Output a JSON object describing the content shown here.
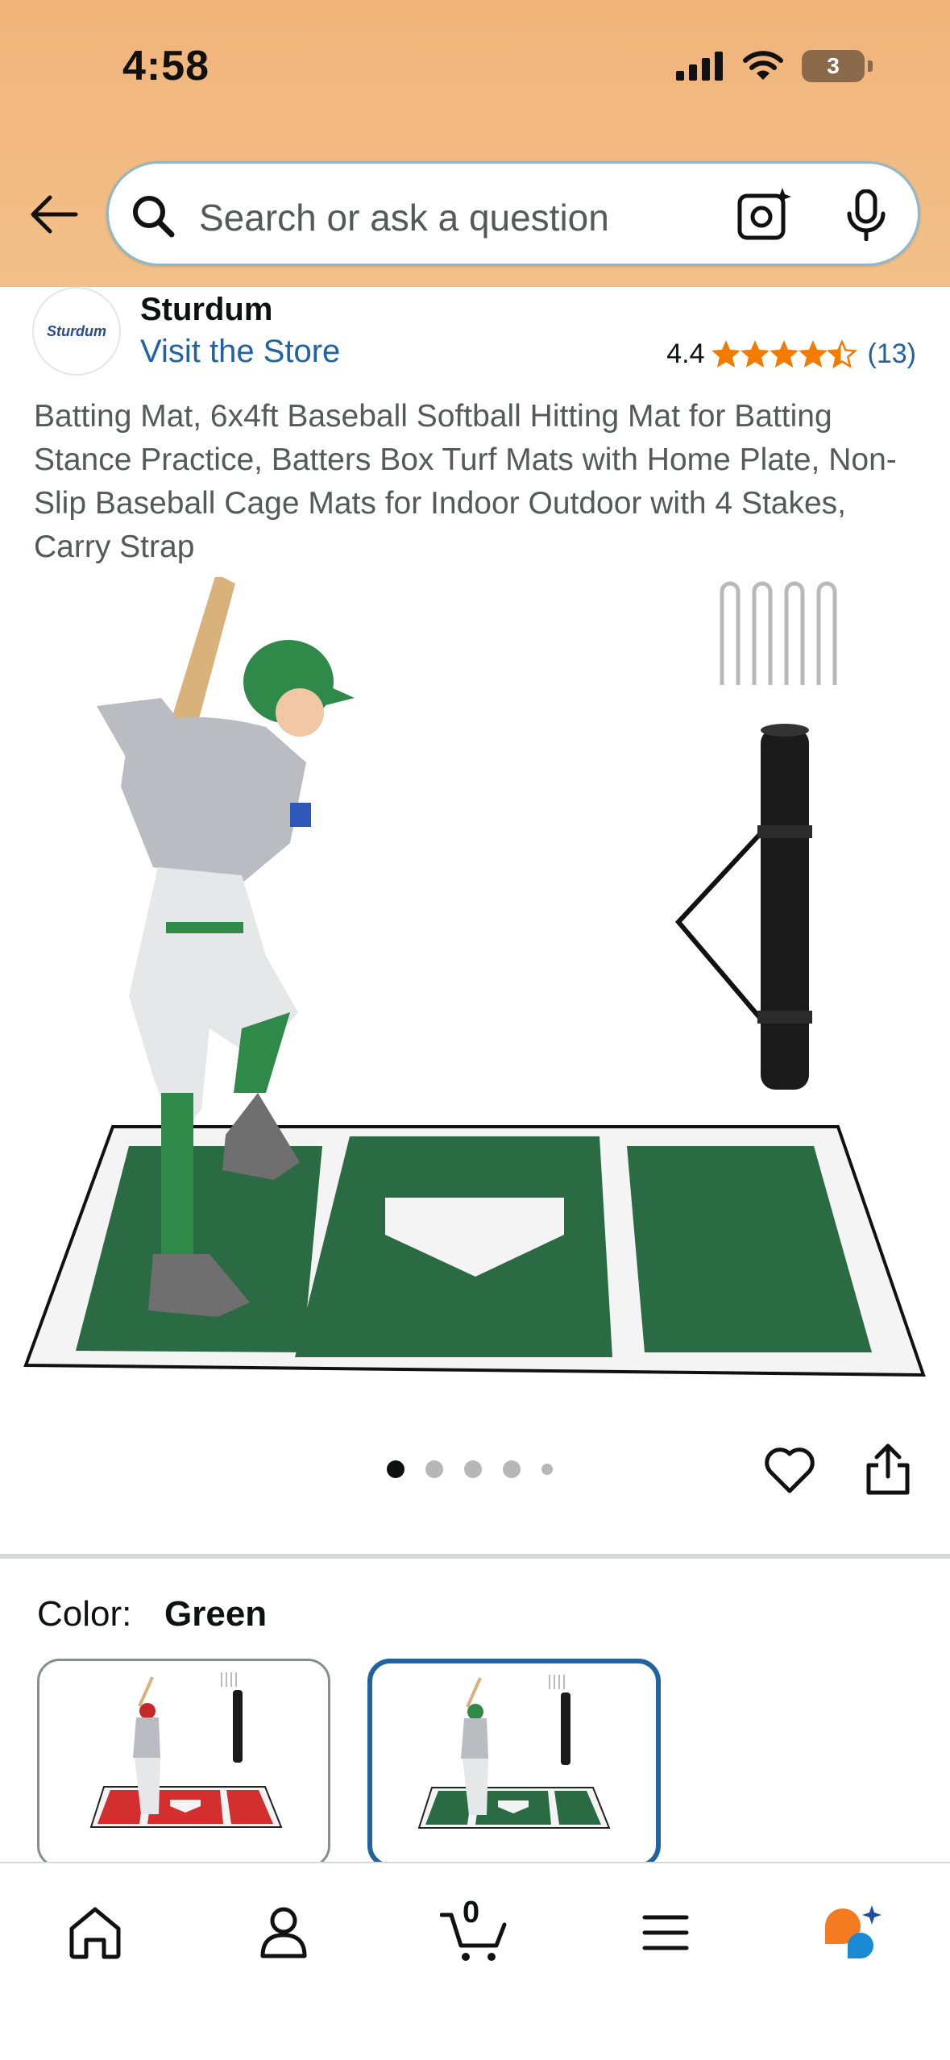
{
  "status_bar": {
    "time": "4:58",
    "battery": "3"
  },
  "search": {
    "placeholder": "Search or ask a question"
  },
  "brand": {
    "logo_text": "Sturdum",
    "name": "Sturdum",
    "visit_store": "Visit the Store"
  },
  "rating": {
    "value": "4.4",
    "stars": 4.4,
    "count": "(13)"
  },
  "product": {
    "title": "Batting Mat, 6x4ft Baseball Softball Hitting Mat for Batting Stance Practice, Batters Box Turf Mats with Home Plate, Non-Slip Baseball Cage Mats for Indoor Outdoor with 4 Stakes, Carry Strap"
  },
  "carousel": {
    "total": 5,
    "active_index": 0
  },
  "color_selector": {
    "label": "Color:",
    "selected": "Green",
    "options": [
      {
        "name": "Red",
        "mat_color": "#d32f2f"
      },
      {
        "name": "Green",
        "mat_color": "#2a6b44"
      }
    ]
  },
  "bottom_nav": {
    "items": [
      {
        "name": "home",
        "icon": "home-icon"
      },
      {
        "name": "account",
        "icon": "person-icon"
      },
      {
        "name": "cart",
        "icon": "cart-icon",
        "count": "0"
      },
      {
        "name": "menu",
        "icon": "hamburger-icon"
      },
      {
        "name": "rufus",
        "icon": "rufus-icon"
      }
    ]
  },
  "colors": {
    "header": "#f3c08a",
    "link": "#2162a1",
    "star": "#f27b00",
    "mat_green": "#2a6b44"
  }
}
